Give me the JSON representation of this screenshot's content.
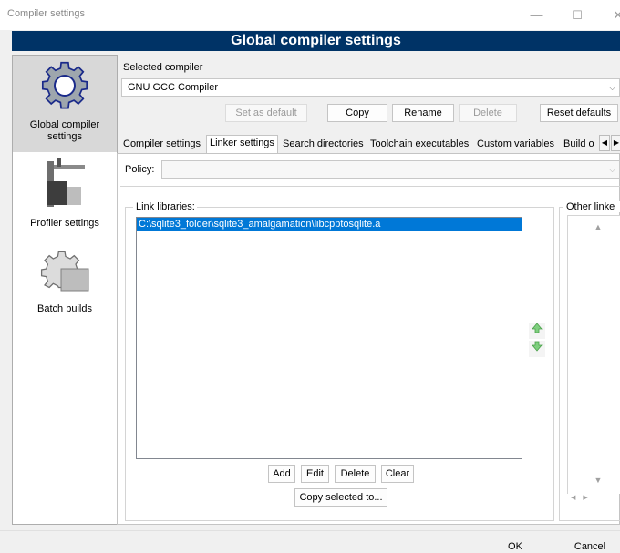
{
  "window": {
    "title": "Compiler settings",
    "minimize_glyph": "—",
    "maximize_glyph": "☐",
    "close_glyph": "✕"
  },
  "banner": {
    "title": "Global compiler settings"
  },
  "left_panel": {
    "items": [
      {
        "label": "Global compiler settings",
        "icon": "gear-icon",
        "selected": true
      },
      {
        "label": "Profiler settings",
        "icon": "caliper-icon",
        "selected": false
      },
      {
        "label": "Batch builds",
        "icon": "batch-gear-icon",
        "selected": false
      }
    ]
  },
  "compiler": {
    "selected_label": "Selected compiler",
    "selected_value": "GNU GCC Compiler",
    "buttons": {
      "set_default": "Set as default",
      "copy": "Copy",
      "rename": "Rename",
      "delete": "Delete",
      "reset_defaults": "Reset defaults"
    }
  },
  "tabs": [
    {
      "label": "Compiler settings",
      "active": false
    },
    {
      "label": "Linker settings",
      "active": true
    },
    {
      "label": "Search directories",
      "active": false
    },
    {
      "label": "Toolchain executables",
      "active": false
    },
    {
      "label": "Custom variables",
      "active": false
    },
    {
      "label": "Build o",
      "active": false
    }
  ],
  "tab_scroll": {
    "left": "◀",
    "right": "▶"
  },
  "linker": {
    "policy_label": "Policy:",
    "policy_value": "",
    "link_libraries_label": "Link libraries:",
    "libraries": [
      "C:\\sqlite3_folder\\sqlite3_amalgamation\\libcpptosqlite.a"
    ],
    "other_linker_label": "Other linke",
    "buttons": {
      "add": "Add",
      "edit": "Edit",
      "delete": "Delete",
      "clear": "Clear",
      "copy_selected": "Copy selected to..."
    },
    "move_up_icon": "arrow-up-icon",
    "move_down_icon": "arrow-down-icon"
  },
  "footer": {
    "ok": "OK",
    "cancel": "Cancel"
  },
  "colors": {
    "banner_bg": "#003366",
    "selection": "#0078d7",
    "move_arrow": "#5cbf5c"
  }
}
